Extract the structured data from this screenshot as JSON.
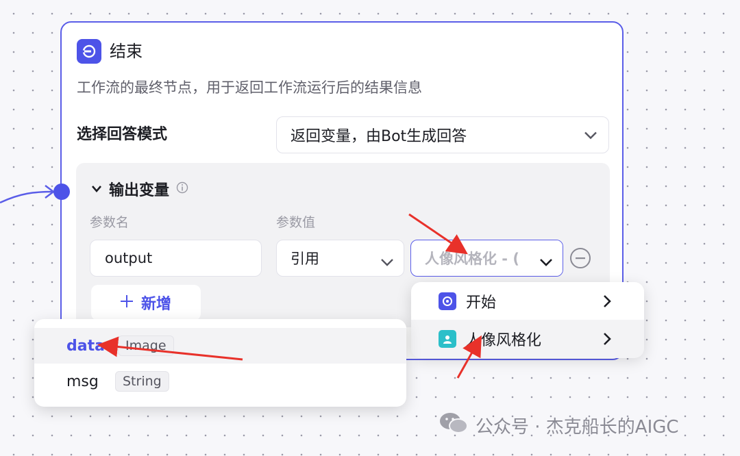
{
  "node": {
    "title": "结束",
    "description": "工作流的最终节点，用于返回工作流运行后的结果信息",
    "icon": "end-node-icon"
  },
  "answer_mode": {
    "label": "选择回答模式",
    "value": "返回变量，由Bot生成回答"
  },
  "output_vars": {
    "title": "输出变量",
    "col_name": "参数名",
    "col_value": "参数值",
    "row": {
      "name": "output",
      "ref_type": "引用",
      "ref_value": "人像风格化 - ("
    },
    "add_label": "新增"
  },
  "node_menu": {
    "items": [
      {
        "label": "开始",
        "icon": "start-node-icon"
      },
      {
        "label": "人像风格化",
        "icon": "portrait-node-icon"
      }
    ]
  },
  "var_menu": {
    "items": [
      {
        "name": "data",
        "type": "Image"
      },
      {
        "name": "msg",
        "type": "String"
      }
    ]
  },
  "watermark": "公众号 · 杰克船长的AIGC",
  "colors": {
    "accent": "#4d53e8",
    "arrow": "#e8312a",
    "teal": "#2bbfc9"
  }
}
